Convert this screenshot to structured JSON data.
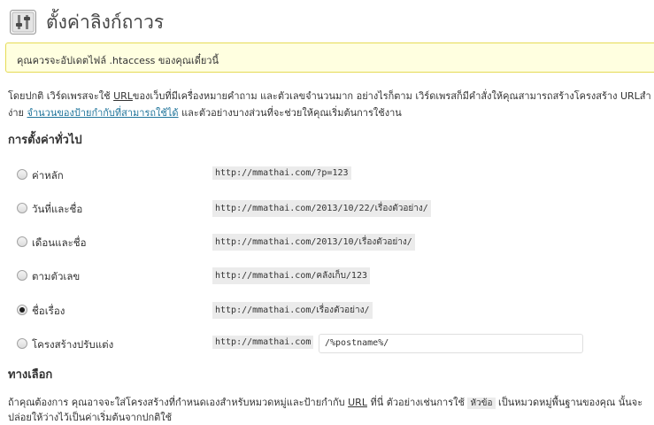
{
  "title": "ตั้งค่าลิงก์ถาวร",
  "notice": "คุณควรจะอัปเดตไฟล์ .htaccess ของคุณเดี๋ยวนี้",
  "intro": {
    "line1_pre": "โดยปกติ เวิร์ดเพรสจะใช้ ",
    "line1_url": "URL",
    "line1_post": "ของเว็บที่มีเครื่องหมายคำถาม และตัวเลขจำนวนมาก อย่างไรก็ตาม เวิร์ดเพรสก็มีคำสั่งให้คุณสามารถสร้างโครงสร้าง URLสำ",
    "line2_pre": "ง่าย ",
    "line2_link": "จำนวนของป้ายกำกับที่สามารถใช้ได้",
    "line2_post": " และตัวอย่างบางส่วนที่จะช่วยให้คุณเริ่มต้นการใช้งาน"
  },
  "general_heading": "การตั้งค่าทั่วไป",
  "permalink_options": [
    {
      "label": "ค่าหลัก",
      "example": "http://mmathai.com/?p=123",
      "checked": false
    },
    {
      "label": "วันที่และชื่อ",
      "example": "http://mmathai.com/2013/10/22/เรื่องตัวอย่าง/",
      "checked": false
    },
    {
      "label": "เดือนและชื่อ",
      "example": "http://mmathai.com/2013/10/เรื่องตัวอย่าง/",
      "checked": false
    },
    {
      "label": "ตามตัวเลข",
      "example": "http://mmathai.com/คลังเก็บ/123",
      "checked": false
    },
    {
      "label": "ชื่อเรื่อง",
      "example": "http://mmathai.com/เรื่องตัวอย่าง/",
      "checked": true
    }
  ],
  "custom": {
    "label": "โครงสร้างปรับแต่ง",
    "base": "http://mmathai.com",
    "value": "/%postname%/"
  },
  "options_heading": "ทางเลือก",
  "options_desc": {
    "line1_pre": "ถ้าคุณต้องการ คุณอาจจะใส่โครงสร้างที่กำหนดเองสำหรับหมวดหมู่และป้ายกำกับ ",
    "line1_url": "URL",
    "line1_mid": " ที่นี่ ตัวอย่างเช่นการใช้ ",
    "line1_tag": "หัวข้อ",
    "line1_post": " เป็นหมวดหมู่พื้นฐานของคุณ นั้นจะ",
    "line2": "ปล่อยให้ว่างไว้เป็นค่าเริ่มต้นจากปกติใช้"
  }
}
